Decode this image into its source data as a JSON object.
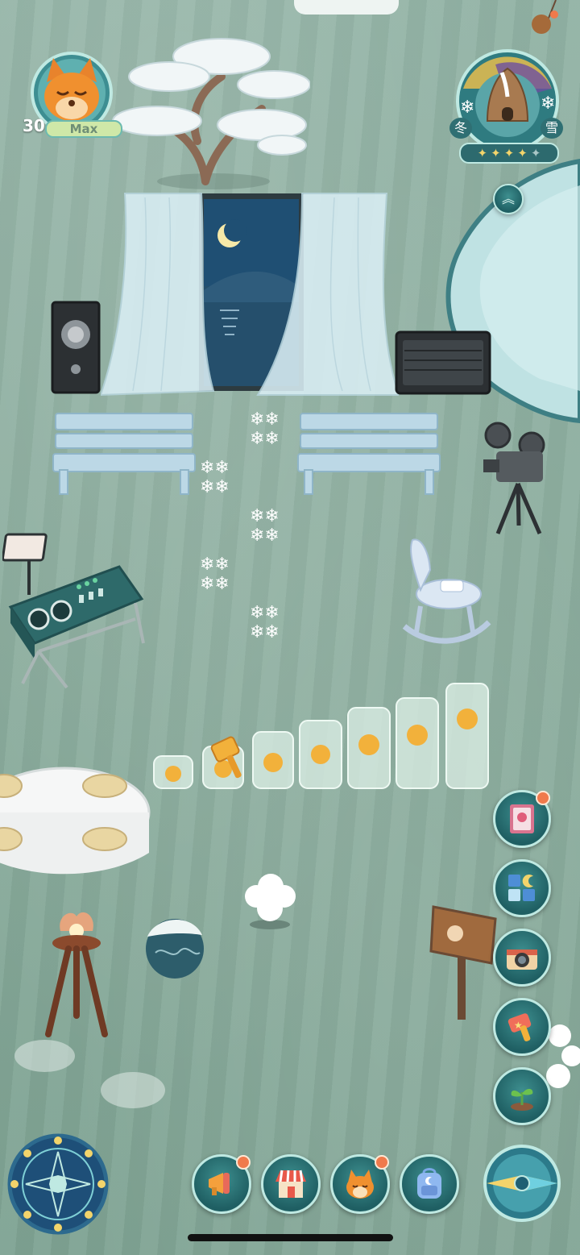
{
  "player": {
    "level": "30",
    "level_status": "Max",
    "avatar_icon": "sleeping-fox-icon"
  },
  "season_badge": {
    "season": "冬",
    "weather": "雪",
    "stars_filled": 4,
    "stars_total": 5,
    "expand_icon": "double-chevron-up-icon"
  },
  "side_menu": [
    {
      "icon": "flower-book-icon",
      "has_badge": true
    },
    {
      "icon": "moon-blocks-icon",
      "has_badge": false
    },
    {
      "icon": "camera-icon",
      "has_badge": false
    },
    {
      "icon": "star-hammer-icon",
      "has_badge": false
    },
    {
      "icon": "sprout-icon",
      "has_badge": false
    }
  ],
  "bottom_bar": [
    {
      "icon": "megaphone-icon",
      "has_badge": true
    },
    {
      "icon": "shop-icon",
      "has_badge": false
    },
    {
      "icon": "fox-friend-icon",
      "has_badge": true
    },
    {
      "icon": "backpack-icon",
      "has_badge": false
    }
  ],
  "corner_controls": {
    "left": "moon-phase-compass-icon",
    "right": "compass-arrow-icon"
  },
  "colors": {
    "ground": "#8fb0a2",
    "button_fill": "#2b7375",
    "button_border": "#bfe9e2",
    "badge": "#f07a4c",
    "accent_gold": "#f2b13b"
  }
}
